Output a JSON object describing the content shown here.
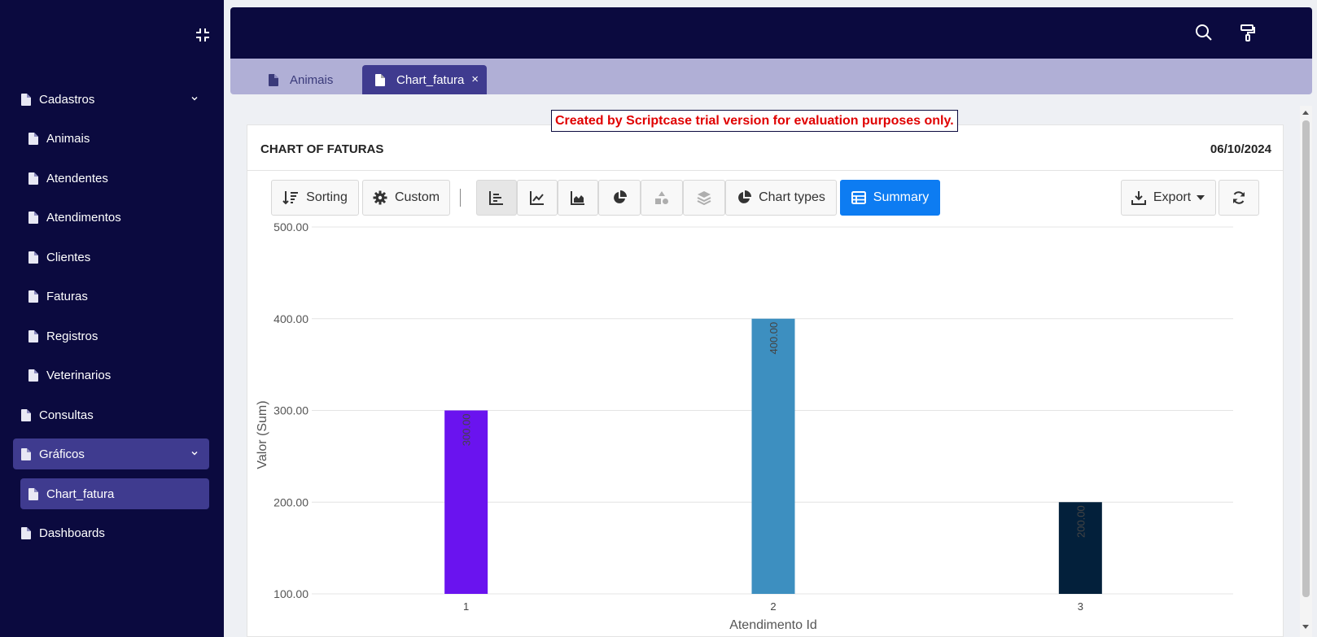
{
  "sidebar": {
    "items": [
      {
        "label": "Cadastros",
        "level": "top",
        "expandable": true,
        "active": false
      },
      {
        "label": "Animais",
        "level": "sub"
      },
      {
        "label": "Atendentes",
        "level": "sub"
      },
      {
        "label": "Atendimentos",
        "level": "sub"
      },
      {
        "label": "Clientes",
        "level": "sub"
      },
      {
        "label": "Faturas",
        "level": "sub"
      },
      {
        "label": "Registros",
        "level": "sub"
      },
      {
        "label": "Veterinarios",
        "level": "sub"
      },
      {
        "label": "Consultas",
        "level": "top",
        "expandable": false
      },
      {
        "label": "Gráficos",
        "level": "top",
        "expandable": true,
        "active": true
      },
      {
        "label": "Chart_fatura",
        "level": "sub",
        "active": true
      },
      {
        "label": "Dashboards",
        "level": "top",
        "expandable": false
      }
    ]
  },
  "tabs": [
    {
      "label": "Animais",
      "close": "×"
    },
    {
      "label": "Chart_fatura",
      "close": "×",
      "active": true
    }
  ],
  "trial_notice": "Created by Scriptcase trial version for evaluation purposes only.",
  "panel": {
    "title": "CHART OF FATURAS",
    "date": "06/10/2024"
  },
  "toolbar": {
    "sorting": "Sorting",
    "custom": "Custom",
    "chart_types": "Chart types",
    "summary": "Summary",
    "export": "Export"
  },
  "colors": {
    "sidebar_bg": "#0b0a3f",
    "active_item": "#3f3b8f",
    "tabs_bg": "#b0afd6",
    "primary": "#0d7cf2",
    "trial_text": "#e00000"
  },
  "chart_data": {
    "type": "bar",
    "categories": [
      "1",
      "2",
      "3"
    ],
    "values": [
      300,
      400,
      200
    ],
    "data_labels": [
      "300.00",
      "400.00",
      "200.00"
    ],
    "bar_colors": [
      "#6a13ef",
      "#3d8fc0",
      "#03203b"
    ],
    "xlabel": "Atendimento Id",
    "ylabel": "Valor (Sum)",
    "yticks": [
      "100.00",
      "200.00",
      "300.00",
      "400.00",
      "500.00"
    ],
    "ylim": [
      100,
      500
    ],
    "grid": true
  }
}
